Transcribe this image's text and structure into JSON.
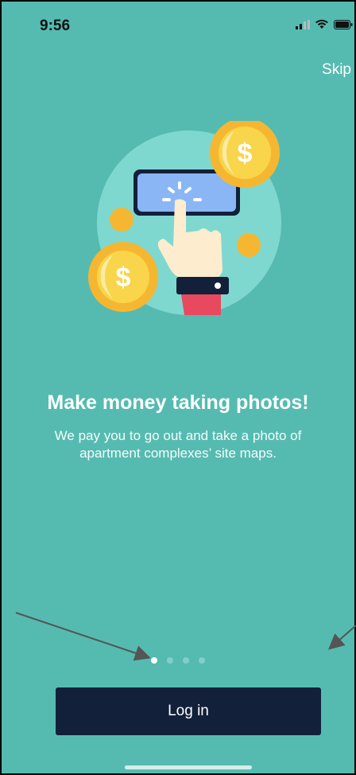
{
  "status_bar": {
    "time": "9:56"
  },
  "header": {
    "skip_label": "Skip"
  },
  "onboarding": {
    "title": "Make money taking photos!",
    "description": "We pay you to go out and take a photo of apartment complexes’ site maps.",
    "page_count": 4,
    "current_page": 1
  },
  "actions": {
    "login_label": "Log in"
  },
  "colors": {
    "background": "#55bbb1",
    "button": "#12203a",
    "coin": "#f5b731",
    "phone_screen": "#8ab6f5"
  },
  "icons": [
    "signal-icon",
    "wifi-icon",
    "battery-icon",
    "hand-tap-illustration",
    "dollar-coin-icon"
  ]
}
